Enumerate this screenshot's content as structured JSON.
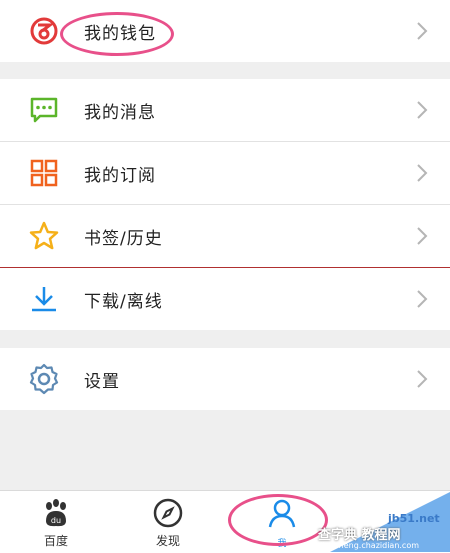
{
  "menu": {
    "wallet": {
      "label": "我的钱包",
      "icon": "wallet-icon"
    },
    "messages": {
      "label": "我的消息",
      "icon": "message-icon"
    },
    "subscriptions": {
      "label": "我的订阅",
      "icon": "grid-icon"
    },
    "bookmarks": {
      "label": "书签/历史",
      "icon": "star-icon"
    },
    "downloads": {
      "label": "下载/离线",
      "icon": "download-icon"
    },
    "settings": {
      "label": "设置",
      "icon": "gear-icon"
    }
  },
  "tabbar": {
    "home": {
      "label": "百度",
      "icon": "baidu-paw-icon"
    },
    "discover": {
      "label": "发现",
      "icon": "compass-icon"
    },
    "me": {
      "label": "我",
      "icon": "person-icon"
    }
  },
  "watermark": {
    "line1": "查字典 教程网",
    "line2": "jiaocheng.chazidian.com",
    "site": "jb51.net"
  },
  "colors": {
    "highlight_ring": "#e8508a",
    "accent_blue": "#1a8be8",
    "wallet_red": "#e23a3a",
    "message_green": "#5bb52a",
    "grid_orange": "#f0621e",
    "star_yellow": "#f5b019"
  }
}
